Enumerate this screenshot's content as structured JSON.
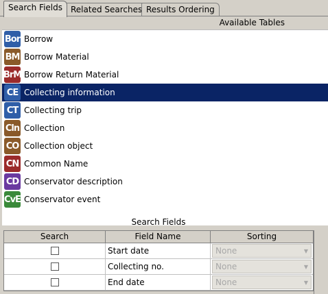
{
  "tabs": [
    {
      "label": "Search Fields",
      "active": true
    },
    {
      "label": "Related Searches",
      "active": false
    },
    {
      "label": "Results Ordering",
      "active": false
    }
  ],
  "available_tables": {
    "title": "Available Tables",
    "selected_index": 3,
    "items": [
      {
        "label": "Borrow",
        "icon_text": "Bor",
        "icon": "borrow-icon",
        "color": "#2f5ea8"
      },
      {
        "label": "Borrow Material",
        "icon_text": "BM",
        "icon": "borrow-material-icon",
        "color": "#8a5a2a"
      },
      {
        "label": "Borrow Return Material",
        "icon_text": "BrM",
        "icon": "borrow-return-material-icon",
        "color": "#9b2b2b"
      },
      {
        "label": "Collecting information",
        "icon_text": "CE",
        "icon": "collecting-information-icon",
        "color": "#2f5ea8"
      },
      {
        "label": "Collecting trip",
        "icon_text": "CT",
        "icon": "collecting-trip-icon",
        "color": "#2f5ea8"
      },
      {
        "label": "Collection",
        "icon_text": "Cln",
        "icon": "collection-icon",
        "color": "#8a5a2a"
      },
      {
        "label": "Collection object",
        "icon_text": "CO",
        "icon": "collection-object-icon",
        "color": "#8a5a2a"
      },
      {
        "label": "Common Name",
        "icon_text": "CN",
        "icon": "common-name-icon",
        "color": "#9b2b2b"
      },
      {
        "label": "Conservator description",
        "icon_text": "CD",
        "icon": "conservator-description-icon",
        "color": "#6b3aa0"
      },
      {
        "label": "Conservator event",
        "icon_text": "CvE",
        "icon": "conservator-event-icon",
        "color": "#3a8a3a"
      }
    ]
  },
  "search_fields": {
    "title": "Search Fields",
    "columns": [
      "Search",
      "Field Name",
      "Sorting"
    ],
    "rows": [
      {
        "search": false,
        "field": "Start date",
        "sorting": "None"
      },
      {
        "search": false,
        "field": "Collecting no.",
        "sorting": "None"
      },
      {
        "search": false,
        "field": "End date",
        "sorting": "None"
      }
    ]
  }
}
